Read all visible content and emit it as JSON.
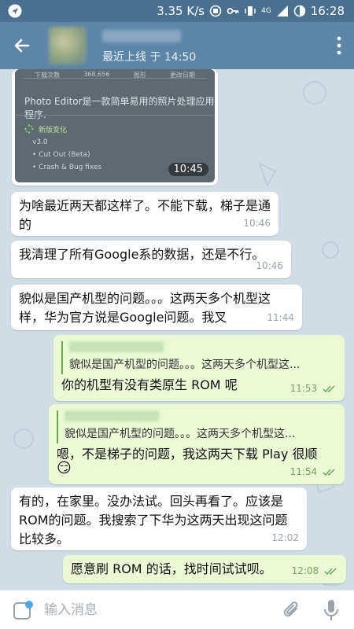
{
  "status_bar": {
    "speed": "3.35 K/s",
    "network": "4G",
    "time": "16:28"
  },
  "header": {
    "subtitle": "最近上线 于 14:50"
  },
  "image_message": {
    "stats": [
      "下载次数",
      "368,656",
      "图形",
      "更改日期"
    ],
    "description": "Photo Editor是一款简单易用的照片处理应用程序.",
    "new_label": "新版变化",
    "version": "v3.0",
    "items": [
      "• Cut Out (Beta)",
      "• Crash & Bug fixes"
    ],
    "time": "10:45"
  },
  "messages": [
    {
      "text": "为啥最近两天都这样了。不能下载，梯子是通的",
      "time": "10:46"
    },
    {
      "text": "我清理了所有Google系的数据，还是不行。",
      "time": "10:46"
    },
    {
      "text": "貌似是国产机型的问题。。。这两天多个机型这样，华为官方说是Google问题。我叉",
      "time": "11:44"
    },
    {
      "reply": "貌似是国产机型的问题。。。这两天多个机型这...",
      "text": "你的机型有没有类原生 ROM 呢",
      "time": "11:53"
    },
    {
      "reply": "貌似是国产机型的问题。。。这两天多个机型这...",
      "text": "嗯，不是梯子的问题，我这两天下载 Play 很顺",
      "emoji": "😏",
      "time": "11:54"
    },
    {
      "text": "有的，在家里。没办法试。回头再看了。应该是ROM的问题。我搜索了下华为这两天出现这问题比较多。",
      "time": "12:02"
    },
    {
      "text": "愿意刷 ROM 的话，找时间试试呗。",
      "time": "12:08"
    }
  ],
  "input": {
    "placeholder": "输入消息",
    "value": ""
  },
  "colors": {
    "header": "#5b86a8",
    "statusbar": "#49708f",
    "outgoing": "#ebf9d5",
    "incoming": "#ffffff",
    "check": "#6ea85f"
  }
}
